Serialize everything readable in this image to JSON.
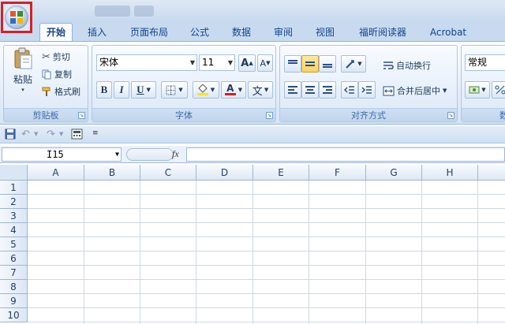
{
  "tabs": [
    {
      "label": "开始",
      "active": true
    },
    {
      "label": "插入"
    },
    {
      "label": "页面布局"
    },
    {
      "label": "公式"
    },
    {
      "label": "数据"
    },
    {
      "label": "审阅"
    },
    {
      "label": "视图"
    },
    {
      "label": "福昕阅读器"
    },
    {
      "label": "Acrobat"
    }
  ],
  "clipboard": {
    "paste": "粘贴",
    "cut": "剪切",
    "copy": "复制",
    "format_painter": "格式刷",
    "group_label": "剪贴板"
  },
  "font": {
    "name": "宋体",
    "size": "11",
    "grow": "A",
    "shrink": "A",
    "bold": "B",
    "italic": "I",
    "underline": "U",
    "fill_letter": "A",
    "wen": "文",
    "group_label": "字体"
  },
  "alignment": {
    "wrap_text": "自动换行",
    "merge_center": "合并后居中",
    "group_label": "对齐方式"
  },
  "number": {
    "format": "常规",
    "group_label_partial": "数"
  },
  "formula_bar": {
    "cell_ref": "I15",
    "fx": "fx"
  },
  "sheet": {
    "columns": [
      "A",
      "B",
      "C",
      "D",
      "E",
      "F",
      "G",
      "H"
    ],
    "rows": [
      "1",
      "2",
      "3",
      "4",
      "5",
      "6",
      "7",
      "8",
      "9",
      "10"
    ]
  },
  "colors": {
    "highlight_box": "#d71f26",
    "fill_yellow": "#ffe500",
    "font_red": "#e01b1b",
    "ribbon_bg": "#dbe8f7"
  }
}
